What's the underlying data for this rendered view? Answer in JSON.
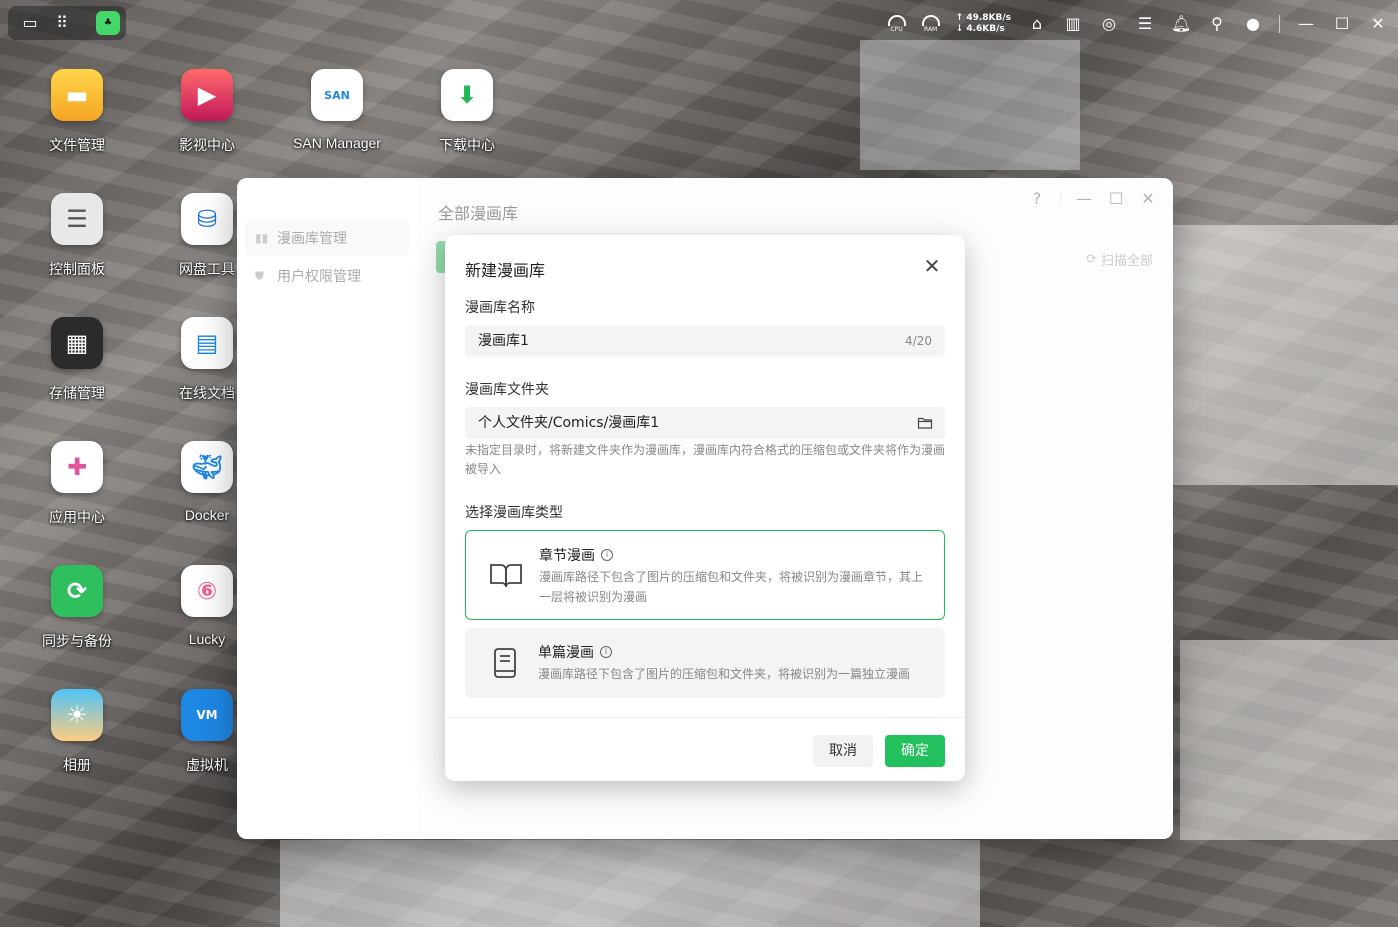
{
  "topbar": {
    "net_up": "↑ 49.8KB/s",
    "net_down": "↓ 4.6KB/s",
    "cpu_label": "CPU",
    "ram_label": "RAM"
  },
  "desktop_icons": [
    {
      "label": "文件管理"
    },
    {
      "label": "影视中心"
    },
    {
      "label": "SAN Manager"
    },
    {
      "label": "下载中心"
    },
    {
      "label": "控制面板"
    },
    {
      "label": "网盘工具"
    },
    {
      "label": "存储管理"
    },
    {
      "label": "在线文档"
    },
    {
      "label": "应用中心"
    },
    {
      "label": "Docker"
    },
    {
      "label": "同步与备份"
    },
    {
      "label": "Lucky"
    },
    {
      "label": "相册"
    },
    {
      "label": "虚拟机"
    }
  ],
  "window": {
    "title": "全部漫画库",
    "help": "?",
    "sidebar": [
      {
        "label": "漫画库管理"
      },
      {
        "label": "用户权限管理"
      }
    ],
    "scan_all": "扫描全部"
  },
  "dialog": {
    "title": "新建漫画库",
    "name_label": "漫画库名称",
    "name_value": "漫画库1",
    "name_count": "4/20",
    "folder_label": "漫画库文件夹",
    "folder_value": "个人文件夹/Comics/漫画库1",
    "hint": "未指定目录时，将新建文件夹作为漫画库，漫画库内符合格式的压缩包或文件夹将作为漫画被导入",
    "type_label": "选择漫画库类型",
    "types": [
      {
        "name": "章节漫画",
        "desc": "漫画库路径下包含了图片的压缩包和文件夹，将被识别为漫画章节，其上一层将被识别为漫画"
      },
      {
        "name": "单篇漫画",
        "desc": "漫画库路径下包含了图片的压缩包和文件夹，将被识别为一篇独立漫画"
      }
    ],
    "cancel": "取消",
    "ok": "确定"
  },
  "colors": {
    "accent": "#22c15e",
    "selected_border": "#22b85a"
  }
}
